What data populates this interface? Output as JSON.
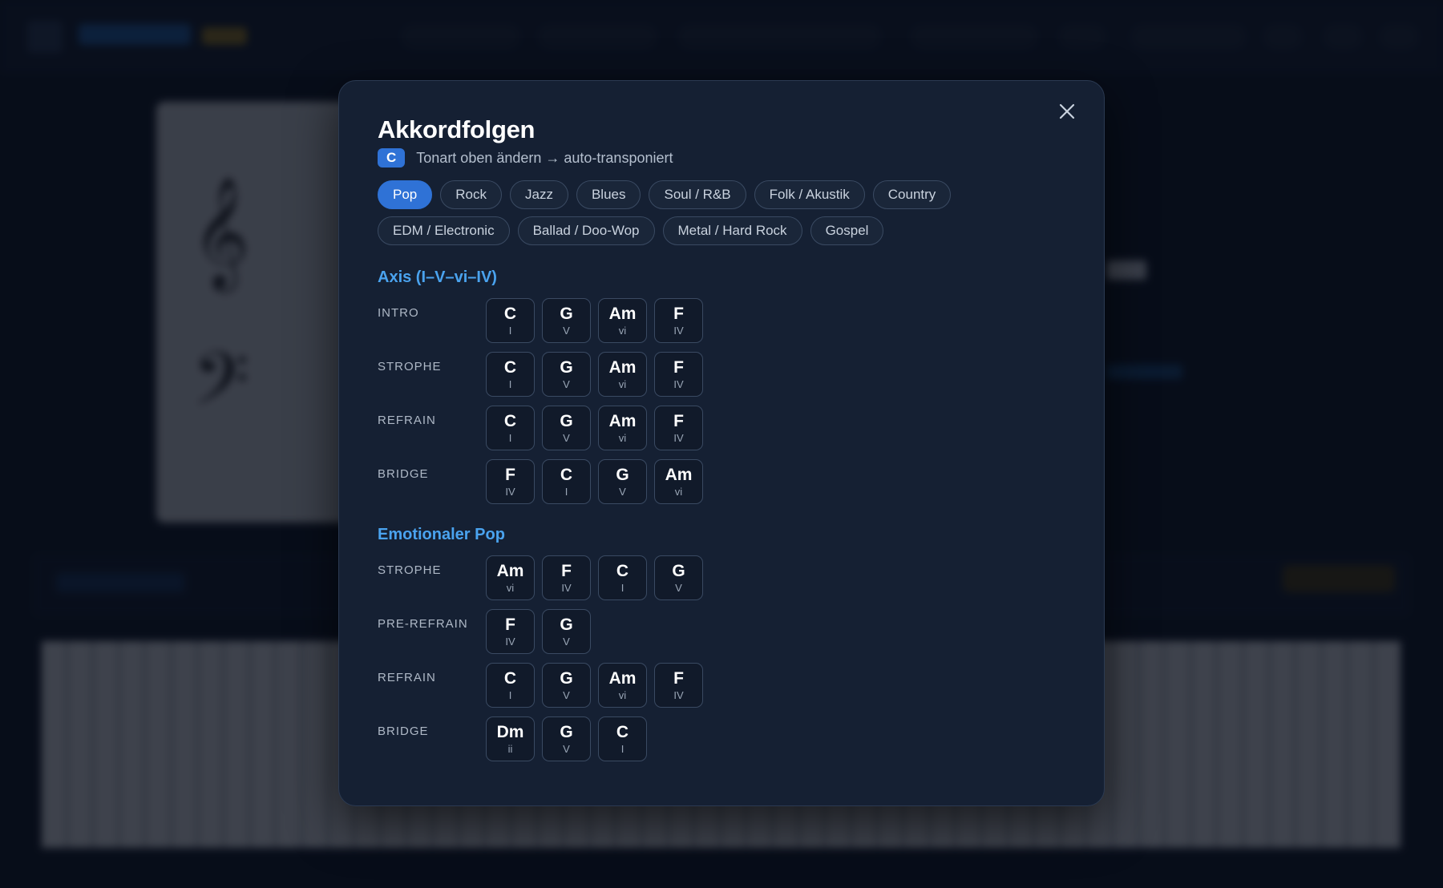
{
  "modal": {
    "title": "Akkordfolgen",
    "key_badge": "C",
    "subtitle": "Tonart oben ändern → auto-transponiert",
    "close_label": "×"
  },
  "genres": [
    {
      "label": "Pop",
      "active": true
    },
    {
      "label": "Rock",
      "active": false
    },
    {
      "label": "Jazz",
      "active": false
    },
    {
      "label": "Blues",
      "active": false
    },
    {
      "label": "Soul / R&B",
      "active": false
    },
    {
      "label": "Folk / Akustik",
      "active": false
    },
    {
      "label": "Country",
      "active": false
    },
    {
      "label": "EDM / Electronic",
      "active": false
    },
    {
      "label": "Ballad / Doo-Wop",
      "active": false
    },
    {
      "label": "Metal / Hard Rock",
      "active": false
    },
    {
      "label": "Gospel",
      "active": false
    }
  ],
  "progressions": [
    {
      "title": "Axis (I–V–vi–IV)",
      "sections": [
        {
          "label": "INTRO",
          "chords": [
            {
              "name": "C",
              "numeral": "I"
            },
            {
              "name": "G",
              "numeral": "V"
            },
            {
              "name": "Am",
              "numeral": "vi"
            },
            {
              "name": "F",
              "numeral": "IV"
            }
          ]
        },
        {
          "label": "STROPHE",
          "chords": [
            {
              "name": "C",
              "numeral": "I"
            },
            {
              "name": "G",
              "numeral": "V"
            },
            {
              "name": "Am",
              "numeral": "vi"
            },
            {
              "name": "F",
              "numeral": "IV"
            }
          ]
        },
        {
          "label": "REFRAIN",
          "chords": [
            {
              "name": "C",
              "numeral": "I"
            },
            {
              "name": "G",
              "numeral": "V"
            },
            {
              "name": "Am",
              "numeral": "vi"
            },
            {
              "name": "F",
              "numeral": "IV"
            }
          ]
        },
        {
          "label": "BRIDGE",
          "chords": [
            {
              "name": "F",
              "numeral": "IV"
            },
            {
              "name": "C",
              "numeral": "I"
            },
            {
              "name": "G",
              "numeral": "V"
            },
            {
              "name": "Am",
              "numeral": "vi"
            }
          ]
        }
      ]
    },
    {
      "title": "Emotionaler Pop",
      "sections": [
        {
          "label": "STROPHE",
          "chords": [
            {
              "name": "Am",
              "numeral": "vi"
            },
            {
              "name": "F",
              "numeral": "IV"
            },
            {
              "name": "C",
              "numeral": "I"
            },
            {
              "name": "G",
              "numeral": "V"
            }
          ]
        },
        {
          "label": "PRE-REFRAIN",
          "chords": [
            {
              "name": "F",
              "numeral": "IV"
            },
            {
              "name": "G",
              "numeral": "V"
            }
          ]
        },
        {
          "label": "REFRAIN",
          "chords": [
            {
              "name": "C",
              "numeral": "I"
            },
            {
              "name": "G",
              "numeral": "V"
            },
            {
              "name": "Am",
              "numeral": "vi"
            },
            {
              "name": "F",
              "numeral": "IV"
            }
          ]
        },
        {
          "label": "BRIDGE",
          "chords": [
            {
              "name": "Dm",
              "numeral": "ii"
            },
            {
              "name": "G",
              "numeral": "V"
            },
            {
              "name": "C",
              "numeral": "I"
            }
          ]
        }
      ]
    }
  ],
  "colors": {
    "accent": "#2f72d6",
    "progression_title": "#4aa3ef",
    "modal_bg": "#152033"
  }
}
